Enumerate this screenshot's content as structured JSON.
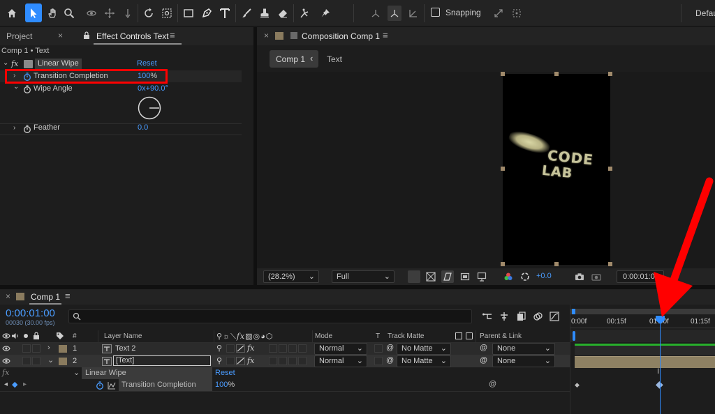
{
  "toolbar": {
    "snapping_label": "Snapping",
    "workspace_label": "Defau"
  },
  "effect_panel": {
    "tab_project": "Project",
    "tab_effect_controls": "Effect Controls Text",
    "breadcrumb": "Comp 1 • Text",
    "effect_fx": "fx",
    "effect_name": "Linear Wipe",
    "reset_label": "Reset",
    "props": [
      {
        "name": "Transition Completion",
        "value": "100",
        "unit": "%"
      },
      {
        "name": "Wipe Angle",
        "value": "0x+90.0°"
      },
      {
        "name": "Feather",
        "value": "0.0"
      }
    ]
  },
  "composition_panel": {
    "tab_title": "Composition Comp 1",
    "flow_comp": "Comp 1",
    "flow_layer": "Text",
    "preview_text_line1": "CODE",
    "preview_text_line2": "LAB",
    "zoom": "(28.2%)",
    "resolution": "Full",
    "exposure": "+0.0",
    "timecode": "0:00:01:00"
  },
  "timeline": {
    "tab_title": "Comp 1",
    "timecode": "0:00:01:00",
    "frame_info": "00030 (30.00 fps)",
    "search_placeholder": "",
    "headers": {
      "num": "#",
      "layer_name": "Layer Name",
      "mode": "Mode",
      "t": "T",
      "track_matte": "Track Matte",
      "parent_link": "Parent & Link"
    },
    "layers": [
      {
        "num": "1",
        "name": "Text 2",
        "mode": "Normal",
        "matte": "No Matte",
        "parent": "None"
      },
      {
        "num": "2",
        "name": "[Text]",
        "mode": "Normal",
        "matte": "No Matte",
        "parent": "None"
      }
    ],
    "effect_row": {
      "name": "Linear Wipe",
      "reset": "Reset"
    },
    "prop_row": {
      "name": "Transition Completion",
      "value": "100",
      "unit": "%"
    },
    "fx_label": "fx",
    "ruler": [
      "0:00f",
      "00:15f",
      "01:00f",
      "01:15f"
    ],
    "colors": {
      "accent_blue": "#2f8cff",
      "green_bar": "#27b02b",
      "annotation_red": "#ff0000"
    }
  }
}
